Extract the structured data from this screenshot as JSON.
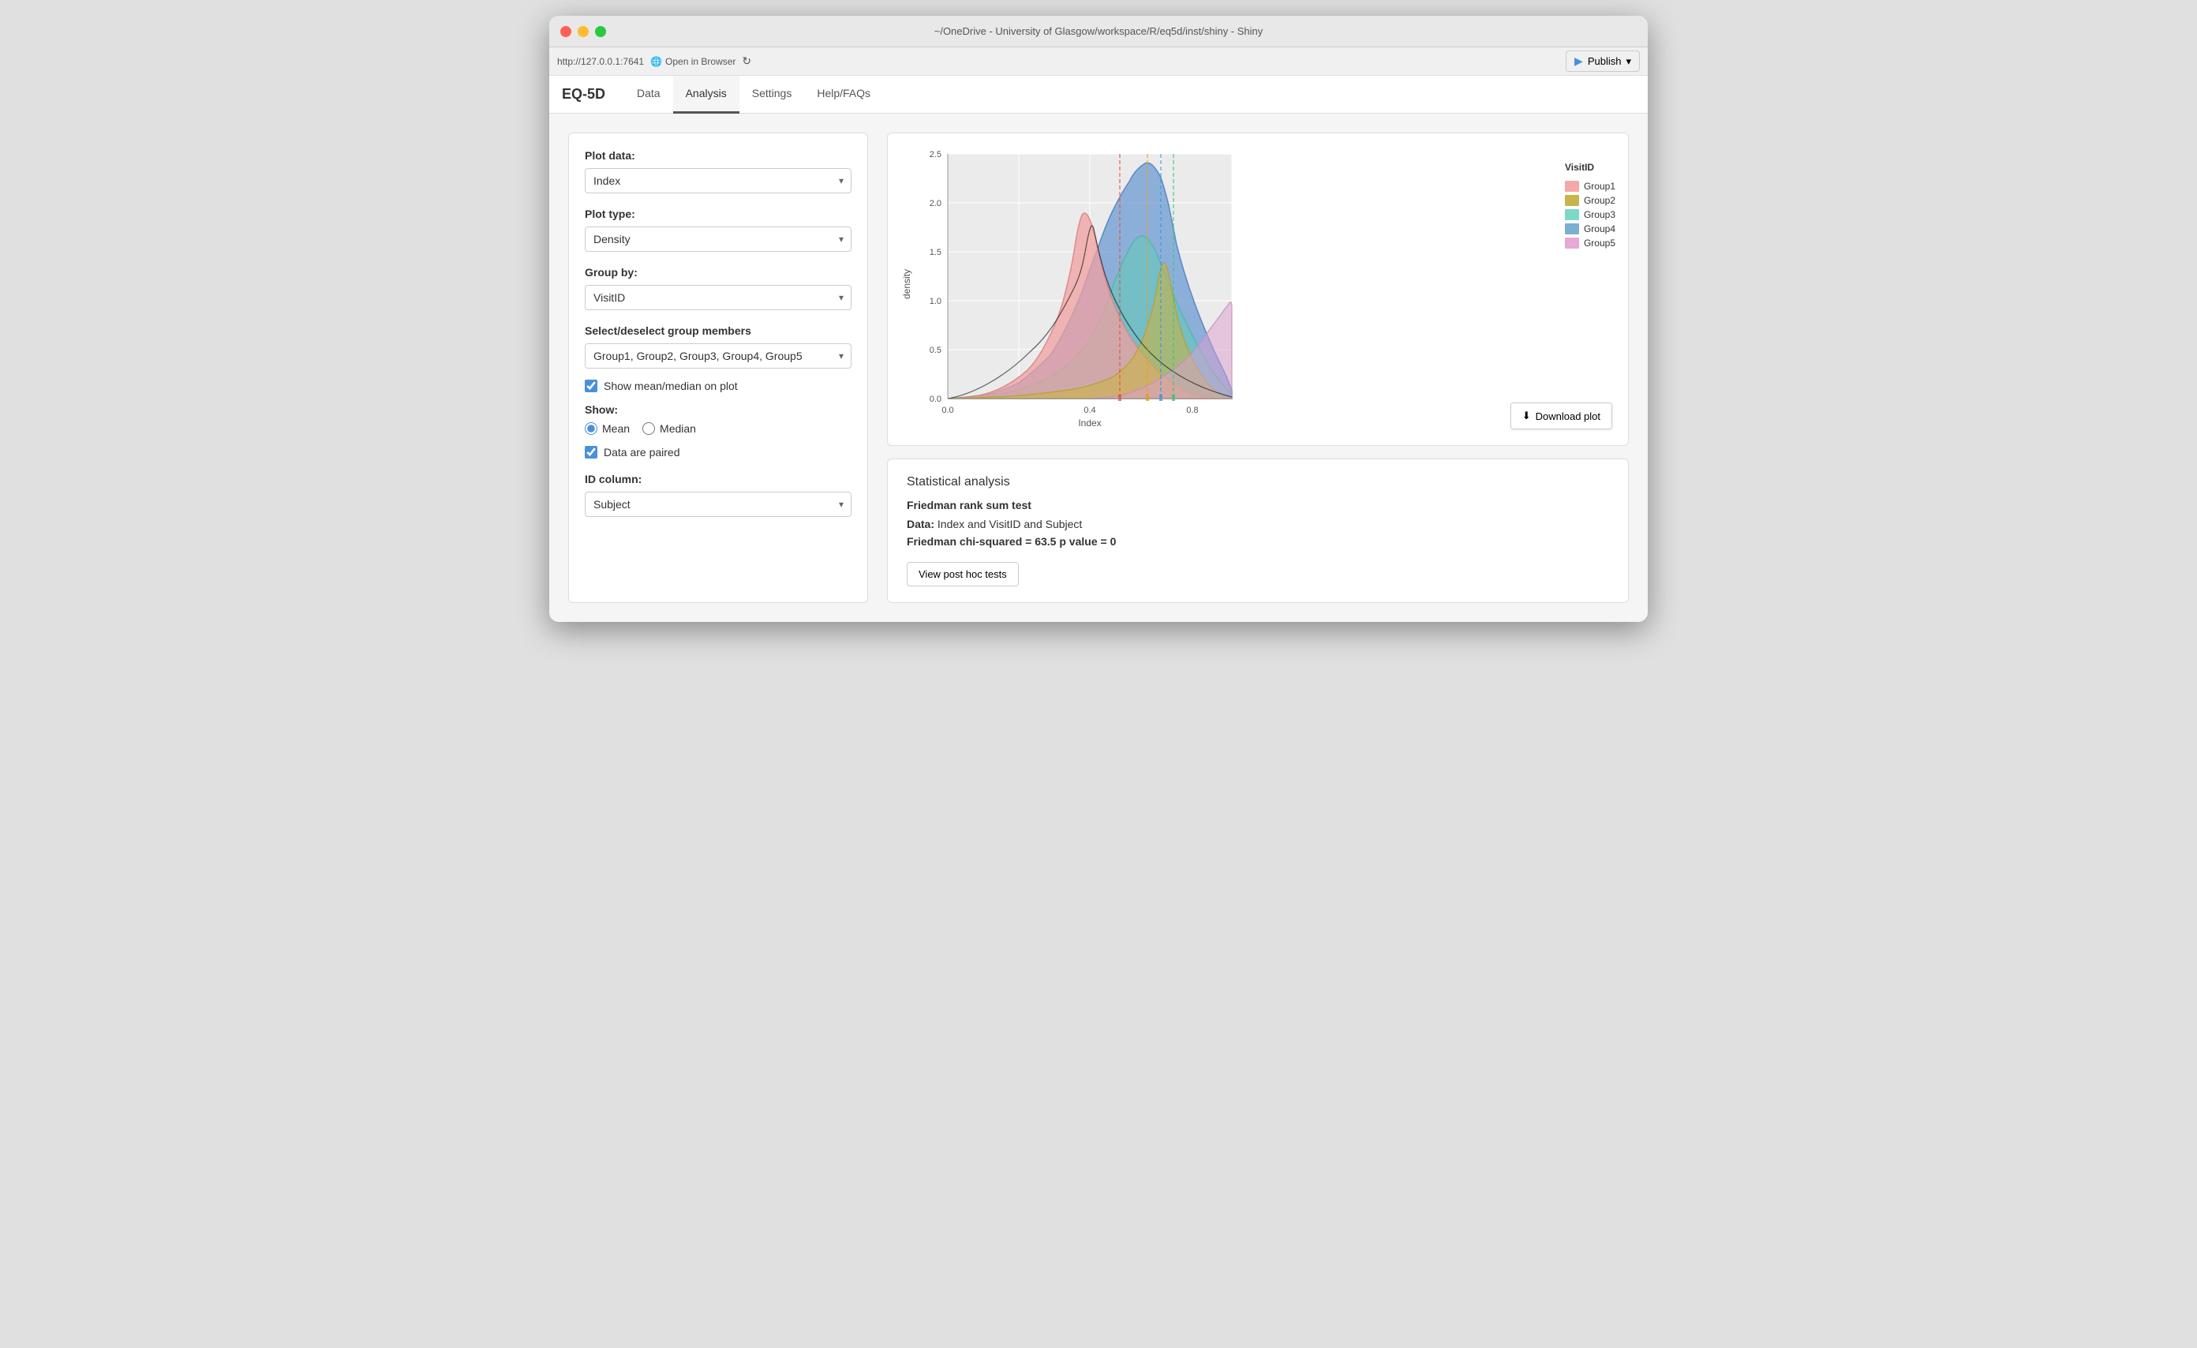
{
  "window": {
    "title": "~/OneDrive - University of Glasgow/workspace/R/eq5d/inst/shiny - Shiny"
  },
  "toolbar": {
    "url": "http://127.0.0.1:7641",
    "open_in_browser": "Open in Browser",
    "publish_label": "Publish"
  },
  "nav": {
    "logo": "EQ-5D",
    "tabs": [
      "Data",
      "Analysis",
      "Settings",
      "Help/FAQs"
    ],
    "active_tab": "Analysis"
  },
  "left_panel": {
    "plot_data_label": "Plot data:",
    "plot_data_value": "Index",
    "plot_type_label": "Plot type:",
    "plot_type_value": "Density",
    "group_by_label": "Group by:",
    "group_by_value": "VisitID",
    "select_group_label": "Select/deselect group members",
    "select_group_value": "Group1, Group2, Group3, Group4, Group5",
    "show_mean_median_label": "Show mean/median on plot",
    "show_section_label": "Show:",
    "mean_label": "Mean",
    "median_label": "Median",
    "data_paired_label": "Data are paired",
    "id_column_label": "ID column:",
    "id_column_value": "Subject"
  },
  "chart": {
    "x_label": "Index",
    "y_label": "density",
    "legend_title": "VisitID",
    "legend_items": [
      {
        "label": "Group1",
        "color": "#f4a8a8"
      },
      {
        "label": "Group2",
        "color": "#c8b44a"
      },
      {
        "label": "Group3",
        "color": "#7dd8c8"
      },
      {
        "label": "Group4",
        "color": "#7bafd4"
      },
      {
        "label": "Group5",
        "color": "#e8a8d4"
      }
    ]
  },
  "download_btn": "Download plot",
  "stats": {
    "title": "Statistical analysis",
    "test_name": "Friedman rank sum test",
    "data_line": "Data: Index and VisitID and Subject",
    "chi_label": "Friedman chi-squared",
    "chi_value": "= 63.5",
    "p_label": "p value",
    "p_value": "= 0",
    "view_btn": "View post hoc tests"
  }
}
